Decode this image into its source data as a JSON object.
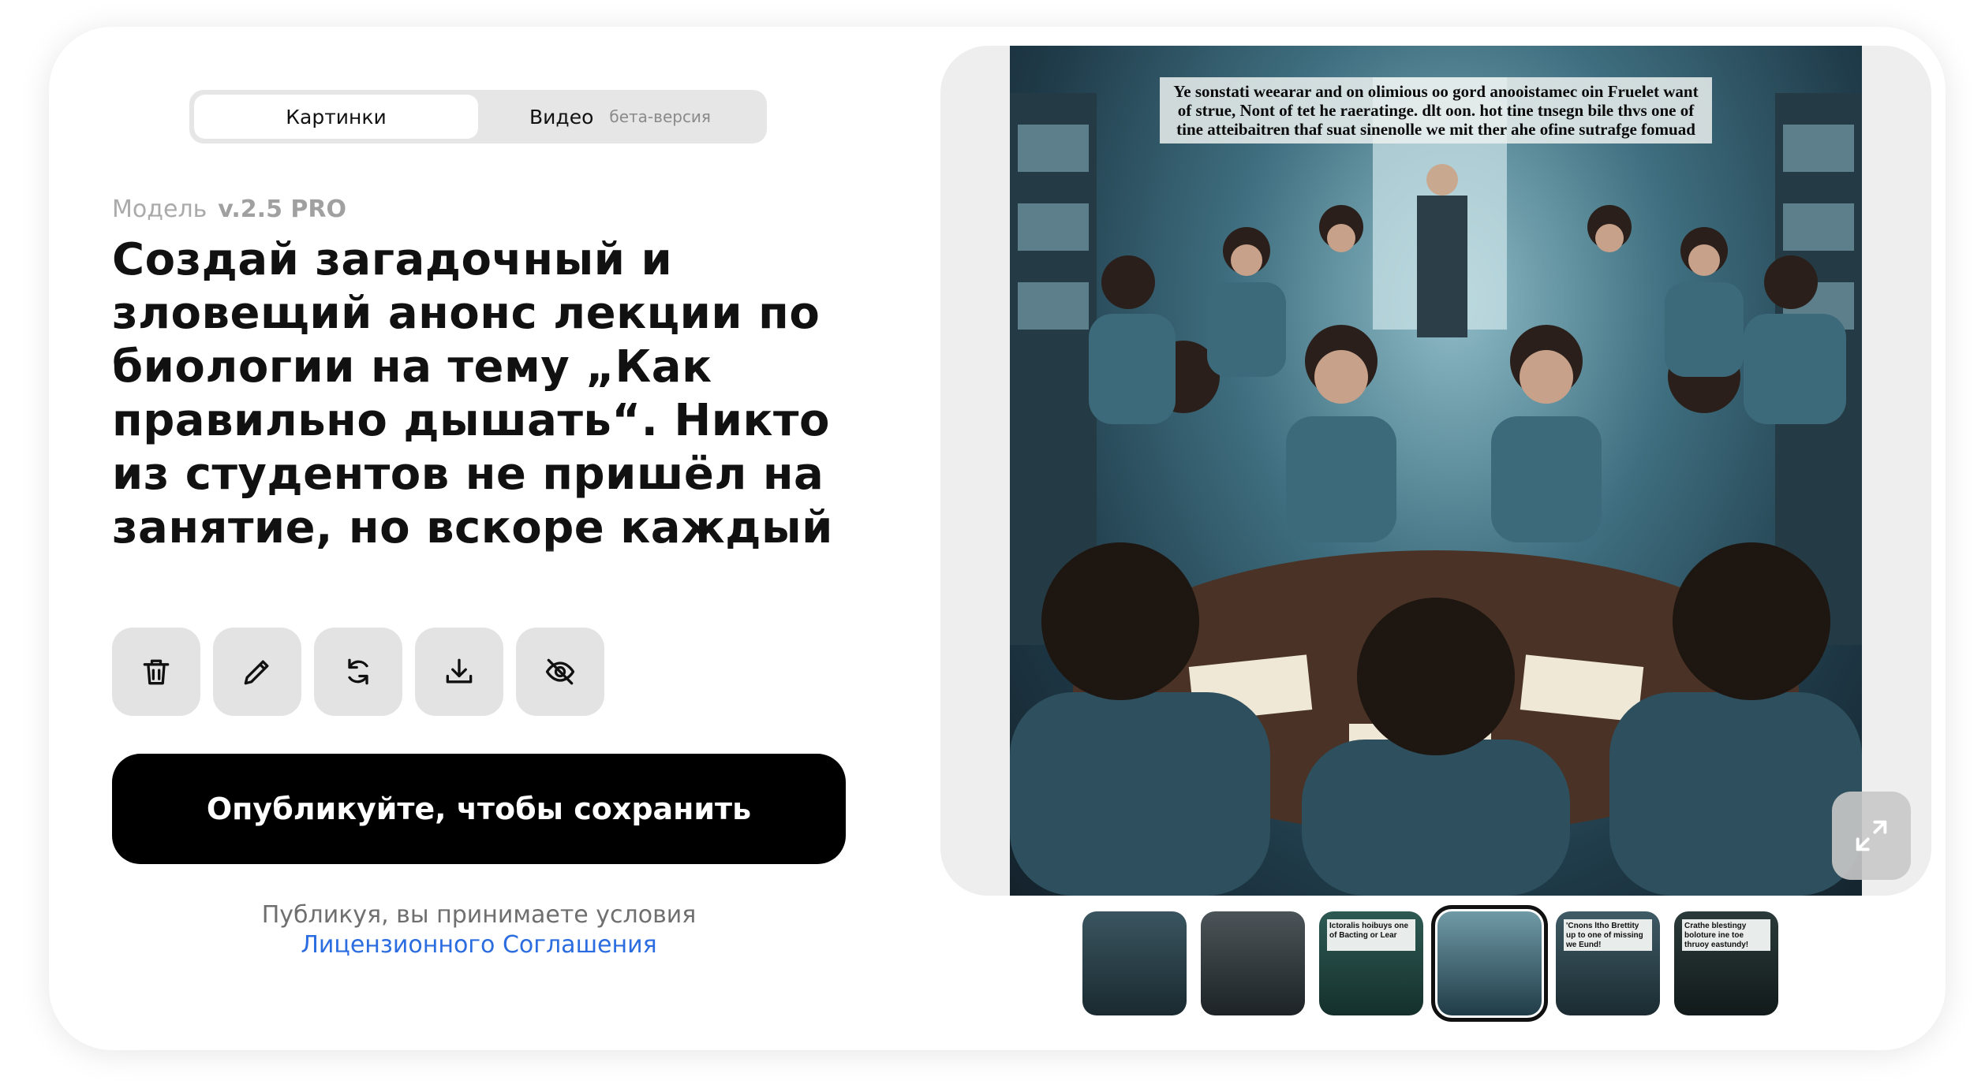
{
  "tabs": {
    "images_label": "Картинки",
    "video_label": "Видео",
    "video_badge": "бета-версия"
  },
  "model": {
    "label": "Модель",
    "version": "v.2.5 PRO"
  },
  "prompt": "Создай загадочный и зловещий анонс лекции по биологии на тему „Как правильно дышать“. Никто из студентов не пришёл на занятие, но вскоре каждый",
  "actions": [
    {
      "icon": "trash-icon"
    },
    {
      "icon": "pencil-icon"
    },
    {
      "icon": "refresh-icon"
    },
    {
      "icon": "download-icon"
    },
    {
      "icon": "eye-off-icon"
    }
  ],
  "publish_label": "Опубликуйте, чтобы сохранить",
  "terms": {
    "text": "Публикуя, вы принимаете условия",
    "link": "Лицензионного Соглашения"
  },
  "image": {
    "caption": "Ye sonstati weearar and on olimious oo gord anooistamec oin Fruelet want of strue, Nont of tet he raeratinge. dlt oon. hot tine tnsegn bile thvs one of tine atteibaitren thaf suat sinenolle we mit ther ahe ofine sutrafge fomuad"
  },
  "expand_icon": "collapse-arrows-icon",
  "thumbnails": [
    {
      "text": "",
      "active": false
    },
    {
      "text": "",
      "active": false
    },
    {
      "text": "Ictoralis hoibuys one of Bacting or Lear",
      "active": false
    },
    {
      "text": "",
      "active": true
    },
    {
      "text": "'Cnons ltho Brettity up to one of missing we Eund!",
      "active": false
    },
    {
      "text": "Crathe blestingy boloture ine toe thruoy eastundy!",
      "active": false
    }
  ]
}
